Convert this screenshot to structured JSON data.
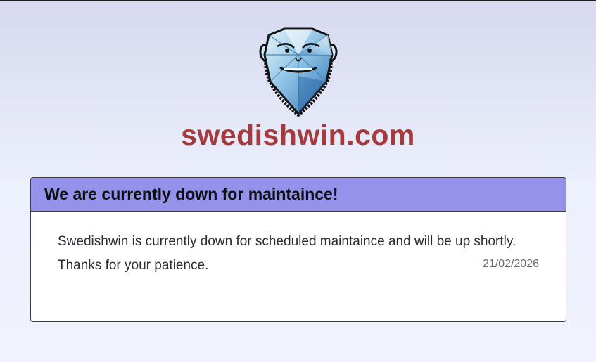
{
  "site": {
    "name": "swedishwin.com",
    "brand_color": "#a43a3c",
    "logo_icon": "diamond-face-logo"
  },
  "notice": {
    "title": "We are currently down for maintaince!",
    "header_color": "#9592ec",
    "lines": [
      "Swedishwin is currently down for scheduled maintaince and will be up shortly.",
      "Thanks for your patience."
    ],
    "date": "21/02/2026"
  }
}
